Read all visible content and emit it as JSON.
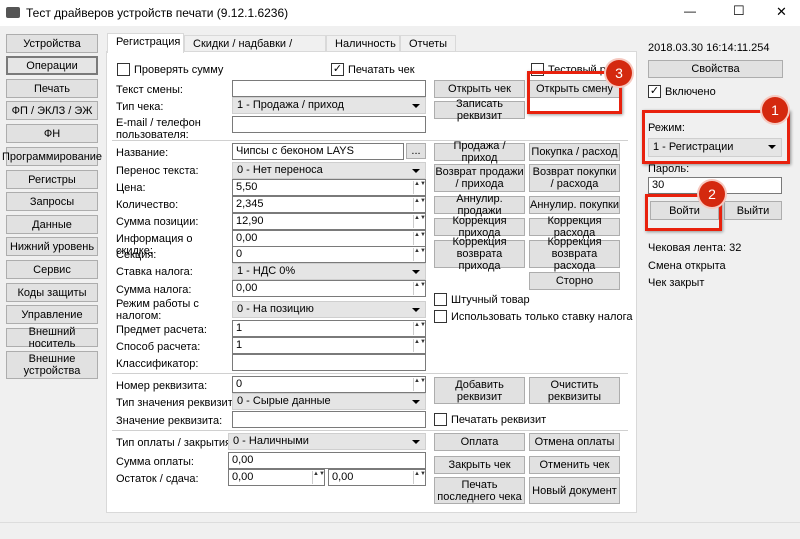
{
  "window": {
    "title": "Тест драйверов устройств печати (9.12.1.6236)",
    "minimize": "—",
    "maximize": "☐",
    "close": "✕"
  },
  "sidebar": [
    "Устройства",
    "Операции",
    "Печать",
    "ФП / ЭКЛЗ / ЭЖ",
    "ФН",
    "Программирование",
    "Регистры",
    "Запросы",
    "Данные",
    "Нижний уровень",
    "Сервис",
    "Коды защиты",
    "Управление",
    "Внешний носитель",
    "Внешние устройства"
  ],
  "tabs": [
    "Регистрация",
    "Скидки / надбавки / налоги",
    "Наличность",
    "Отчеты"
  ],
  "form": {
    "check_sum": "Проверять сумму",
    "print_check": "Печатать чек",
    "test_mode": "Тестовый режим",
    "shift_text": "Текст смены:",
    "check_type": "Тип чека:",
    "check_type_value": "1 - Продажа / приход",
    "email": "E-mail / телефон пользователя:",
    "name": "Название:",
    "name_value": "Чипсы с беконом LAYS",
    "ellipsis": "...",
    "wrap": "Перенос текста:",
    "wrap_value": "0 - Нет переноса",
    "price": "Цена:",
    "price_value": "5,50",
    "qty": "Количество:",
    "qty_value": "2,345",
    "pos_sum": "Сумма позиции:",
    "pos_sum_value": "12,90",
    "discount": "Информация о скидке:",
    "discount_value": "0,00",
    "section": "Секция:",
    "section_value": "0",
    "tax": "Ставка налога:",
    "tax_value": "1 - НДС 0%",
    "tax_sum": "Сумма налога:",
    "tax_sum_value": "0,00",
    "tax_mode": "Режим работы с налогом:",
    "tax_mode_value": "0 - На позицию",
    "subject": "Предмет расчета:",
    "subject_value": "1",
    "method": "Способ расчета:",
    "method_value": "1",
    "classifier": "Классификатор:",
    "req_num": "Номер реквизита:",
    "req_num_value": "0",
    "req_type": "Тип значения реквизита:",
    "req_type_value": "0 - Сырые данные",
    "req_value": "Значение реквизита:",
    "pay_type": "Тип оплаты / закрытия:",
    "pay_type_value": "0 - Наличными",
    "pay_sum": "Сумма оплаты:",
    "pay_sum_value": "0,00",
    "change": "Остаток / сдача:",
    "change_value1": "0,00",
    "change_value2": "0,00"
  },
  "buttons": {
    "open_check": "Открыть чек",
    "open_shift": "Открыть смену",
    "write_req": "Записать реквизит",
    "sale": "Продажа / приход",
    "buy": "Покупка / расход",
    "ret_sale": "Возврат продажи / прихода",
    "ret_buy": "Возврат покупки / расхода",
    "ann_sale": "Аннулир. продажи",
    "ann_buy": "Аннулир. покупки",
    "corr_in": "Коррекция прихода",
    "corr_out": "Коррекция расхода",
    "corr_ret_in": "Коррекция возврата прихода",
    "corr_ret_out": "Коррекция возврата расхода",
    "storno": "Сторно",
    "piece": "Штучный товар",
    "only_tax": "Использовать только ставку налога",
    "add_req": "Добавить реквизит",
    "clear_req": "Очистить реквизиты",
    "print_req": "Печатать реквизит",
    "pay": "Оплата",
    "cancel_pay": "Отмена оплаты",
    "close_check": "Закрыть чек",
    "cancel_check": "Отменить чек",
    "print_last": "Печать последнего чека",
    "new_doc": "Новый документ"
  },
  "right": {
    "datetime": "2018.03.30 16:14:11.254",
    "properties": "Свойства",
    "enabled": "Включено",
    "mode": "Режим:",
    "mode_value": "1 - Регистрации",
    "password": "Пароль:",
    "password_value": "30",
    "login": "Войти",
    "logout": "Выйти",
    "tape": "Чековая лента: 32",
    "shift": "Смена открыта",
    "check": "Чек закрыт"
  },
  "annotations": [
    "1",
    "2",
    "3"
  ],
  "colors": {
    "annotation": "#e8210d"
  }
}
